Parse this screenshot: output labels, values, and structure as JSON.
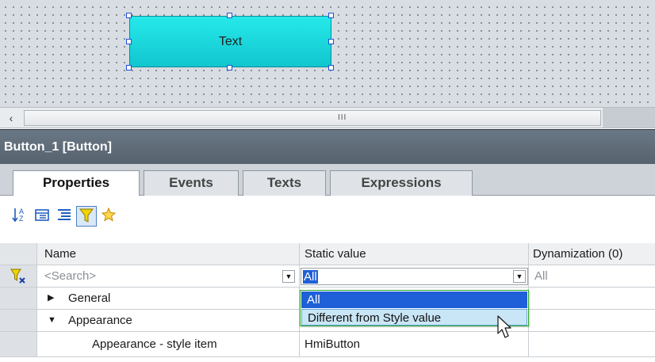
{
  "canvas": {
    "button_text": "Text"
  },
  "scrollbar": {
    "left_arrow": "‹",
    "grip": "III"
  },
  "inspector": {
    "title": "Button_1 [Button]"
  },
  "tabs": [
    {
      "label": "Properties",
      "active": true
    },
    {
      "label": "Events",
      "active": false
    },
    {
      "label": "Texts",
      "active": false
    },
    {
      "label": "Expressions",
      "active": false
    }
  ],
  "toolbar": {
    "icons": [
      "sort-az-icon",
      "group-icon",
      "list-icon",
      "filter-icon",
      "favorites-icon"
    ]
  },
  "grid": {
    "columns": [
      "Name",
      "Static value",
      "Dynamization (0)"
    ],
    "search_placeholder": "<Search>",
    "static_filter_value": "All",
    "dynamization_filter_value": "All",
    "rows": [
      {
        "name": "General",
        "expander": "▶"
      },
      {
        "name": "Appearance",
        "expander": "▼"
      },
      {
        "name": "Appearance - style item",
        "value": "HmiButton"
      }
    ]
  },
  "dropdown": {
    "options": [
      "All",
      "Different from Style value"
    ],
    "selected": "All",
    "hovered": "Different from Style value"
  },
  "colors": {
    "accent": "#1f5fd8",
    "button_fill": "#1ed9dc",
    "inspector_header": "#5f6c78"
  }
}
